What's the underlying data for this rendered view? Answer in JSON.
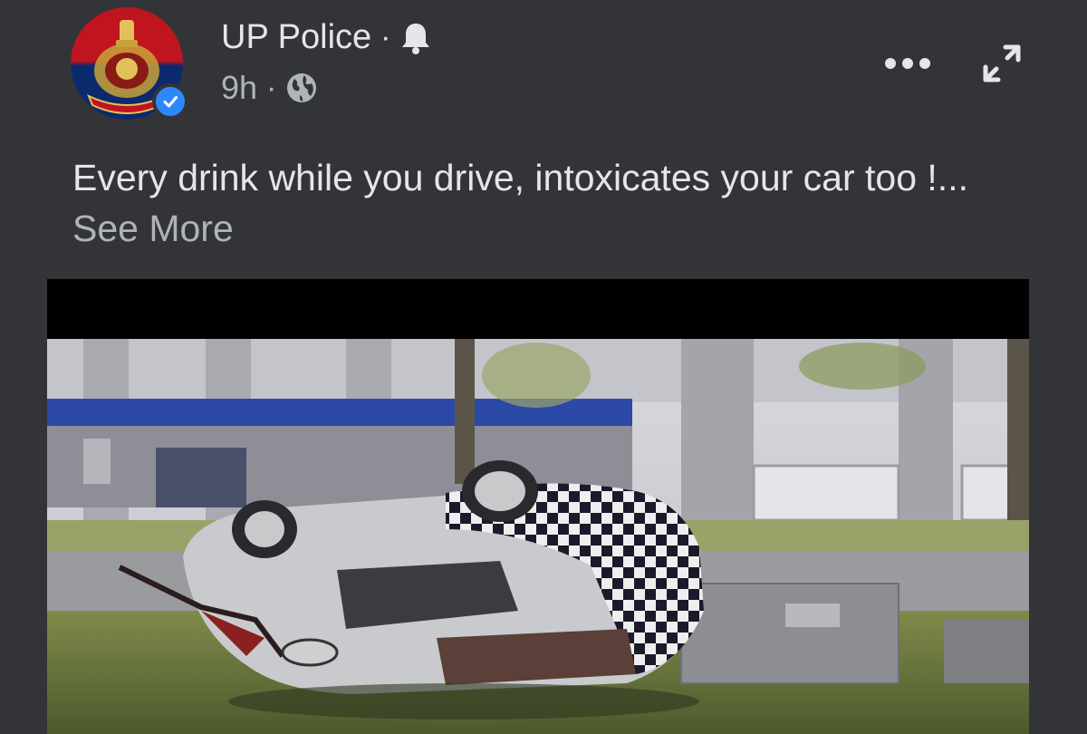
{
  "post": {
    "page_name": "UP Police",
    "separator": "·",
    "time": "9h",
    "caption_text": "Every drink while you drive, intoxicates your car too !",
    "caption_ellipsis": "...",
    "see_more_label": "See More"
  },
  "icons": {
    "notification": "bell-icon",
    "privacy": "globe-icon",
    "verified": "verified-badge-icon",
    "more": "more-options-icon",
    "expand": "expand-icon"
  },
  "colors": {
    "background": "#333437",
    "text_primary": "#e4e6eb",
    "text_secondary": "#b0b3b8",
    "verified_blue": "#2d88ff"
  }
}
